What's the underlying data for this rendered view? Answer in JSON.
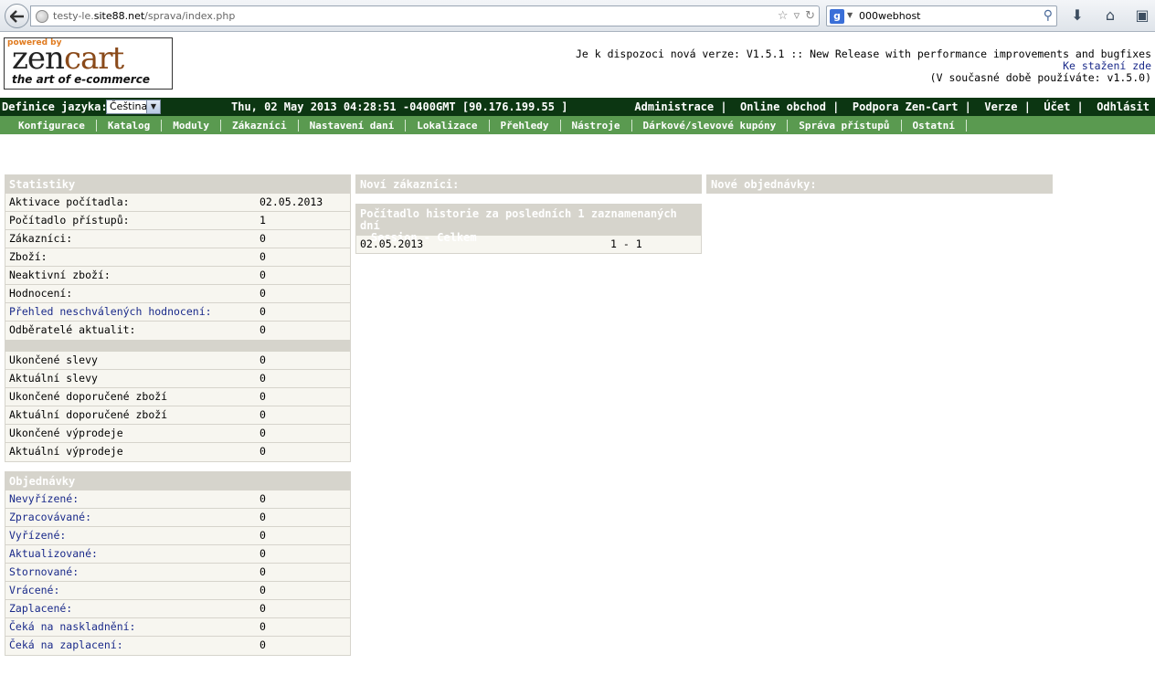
{
  "browser": {
    "url_prefix": "testy-le.",
    "url_host": "site88.net",
    "url_path": "/sprava/index.php",
    "search_value": "000webhost"
  },
  "header": {
    "logo_powered": "powered by",
    "logo_zen": "zen",
    "logo_cart": "cart",
    "logo_tagline": "the art of e-commerce",
    "version_notice": "Je k dispozoci nová verze: V1.5.1 :: New Release with performance improvements and bugfixes",
    "download_link": "Ke stažení zde",
    "current_version": "(V současné době používáte: v1.5.0)"
  },
  "topbar": {
    "lang_label": "Definice jazyka:",
    "lang_selected": "Čeština",
    "datetime": "Thu, 02 May 2013 04:28:51 -0400GMT [90.176.199.55 ]",
    "links": [
      "Administrace",
      "Online obchod",
      "Podpora Zen-Cart",
      "Verze",
      "Účet",
      "Odhlásit"
    ]
  },
  "menu": [
    "Konfigurace",
    "Katalog",
    "Moduly",
    "Zákazníci",
    "Nastavení daní",
    "Lokalizace",
    "Přehledy",
    "Nástroje",
    "Dárkové/slevové kupóny",
    "Správa přístupů",
    "Ostatní"
  ],
  "stats": {
    "title": "Statistiky",
    "rows1": [
      {
        "label": "Aktivace počítadla:",
        "value": "02.05.2013"
      },
      {
        "label": "Počítadlo přístupů:",
        "value": "1"
      },
      {
        "label": "Zákazníci:",
        "value": "0"
      },
      {
        "label": "Zboží:",
        "value": "0"
      },
      {
        "label": "Neaktivní zboží:",
        "value": "0"
      },
      {
        "label": "Hodnocení:",
        "value": "0"
      },
      {
        "label": "Přehled neschválených hodnocení:",
        "value": "0"
      },
      {
        "label": "Odběratelé aktualit:",
        "value": "0"
      }
    ],
    "rows2": [
      {
        "label": "Ukončené slevy",
        "value": "0"
      },
      {
        "label": "Aktuální slevy",
        "value": "0"
      },
      {
        "label": "Ukončené doporučené zboží",
        "value": "0"
      },
      {
        "label": "Aktuální doporučené zboží",
        "value": "0"
      },
      {
        "label": "Ukončené výprodeje",
        "value": "0"
      },
      {
        "label": "Aktuální výprodeje",
        "value": "0"
      }
    ]
  },
  "orders": {
    "title": "Objednávky",
    "rows": [
      {
        "label": "Nevyřízené:",
        "value": "0"
      },
      {
        "label": "Zpracovávané:",
        "value": "0"
      },
      {
        "label": "Vyřízené:",
        "value": "0"
      },
      {
        "label": "Aktualizované:",
        "value": "0"
      },
      {
        "label": "Stornované:",
        "value": "0"
      },
      {
        "label": "Vrácené:",
        "value": "0"
      },
      {
        "label": "Zaplacené:",
        "value": "0"
      },
      {
        "label": "Čeká na naskladnění:",
        "value": "0"
      },
      {
        "label": "Čeká na zaplacení:",
        "value": "0"
      }
    ]
  },
  "new_customers": {
    "title": "Noví zákazníci:"
  },
  "history": {
    "title_line1": "Počítadlo historie za posledních 1 zaznamenaných dní",
    "title_line2": "Session - Celkem",
    "date": "02.05.2013",
    "value": "1 - 1"
  },
  "new_orders": {
    "title": "Nové objednávky:"
  }
}
